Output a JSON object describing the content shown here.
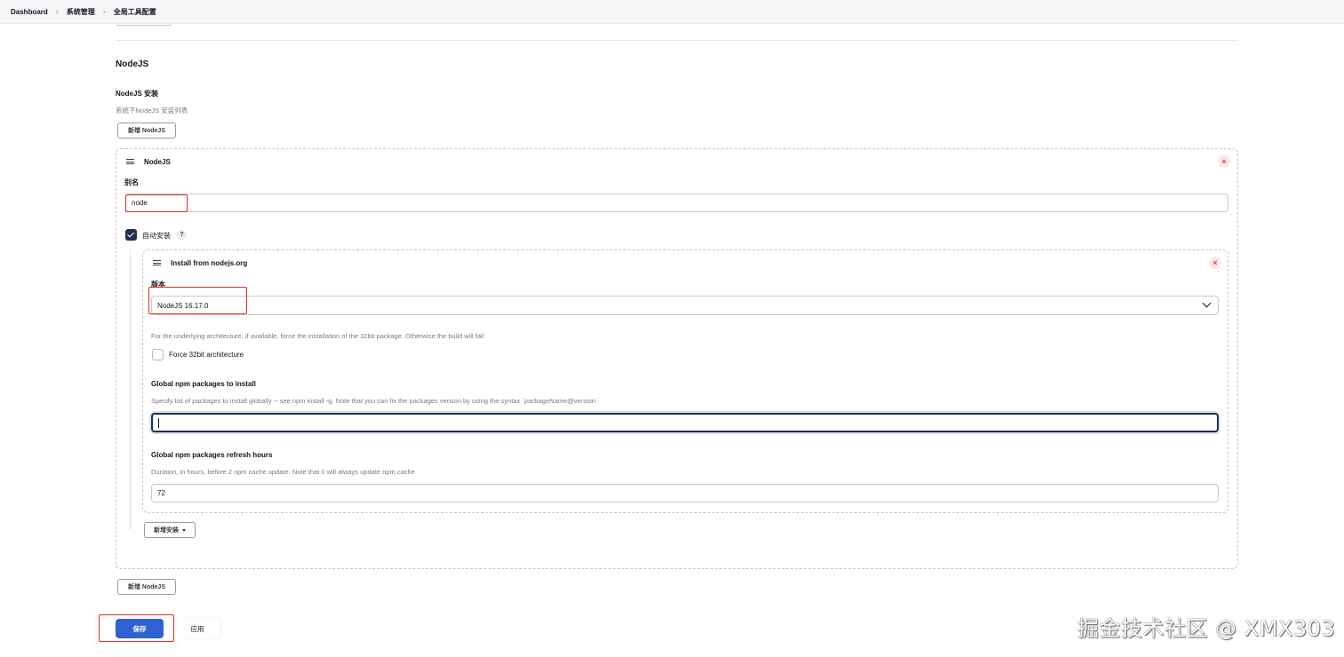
{
  "breadcrumb": {
    "items": [
      "Dashboard",
      "系统管理",
      "全局工具配置"
    ]
  },
  "section": {
    "title": "NodeJS",
    "installs_label": "NodeJS 安装",
    "installs_help": "系统下NodeJS 安装列表",
    "add_button_label": "新增 NodeJS"
  },
  "installation": {
    "title": "NodeJS",
    "name_label": "别名",
    "name_value": "node",
    "auto_install_label": "自动安装",
    "auto_install_checked": true,
    "help_icon": "?",
    "installer": {
      "title": "Install from nodejs.org",
      "version_label": "版本",
      "version_value": "NodeJS 16.17.0",
      "force32_help": "For the underlying architecture, if available, force the installation of the 32bit package. Otherwise the build will fail",
      "force32_label": "Force 32bit architecture",
      "force32_checked": false,
      "npm_packages_label": "Global npm packages to install",
      "npm_packages_help": "Specify list of packages to install globally -- see npm install -g. Note that you can fix the packages version by using the syntax `packageName@version`",
      "npm_packages_value": "",
      "refresh_label": "Global npm packages refresh hours",
      "refresh_help": "Duration, in hours, before 2 npm cache update. Note that 0 will always update npm cache",
      "refresh_value": "72"
    },
    "add_installer_label": "新增安装"
  },
  "footer": {
    "save_label": "保存",
    "apply_label": "应用"
  },
  "watermark": "掘金技术社区 @ XMX303",
  "colors": {
    "primary": "#2f62d1",
    "checkbox": "#1f2f4d",
    "highlight": "#e0301e",
    "delete": "#d9393b"
  }
}
